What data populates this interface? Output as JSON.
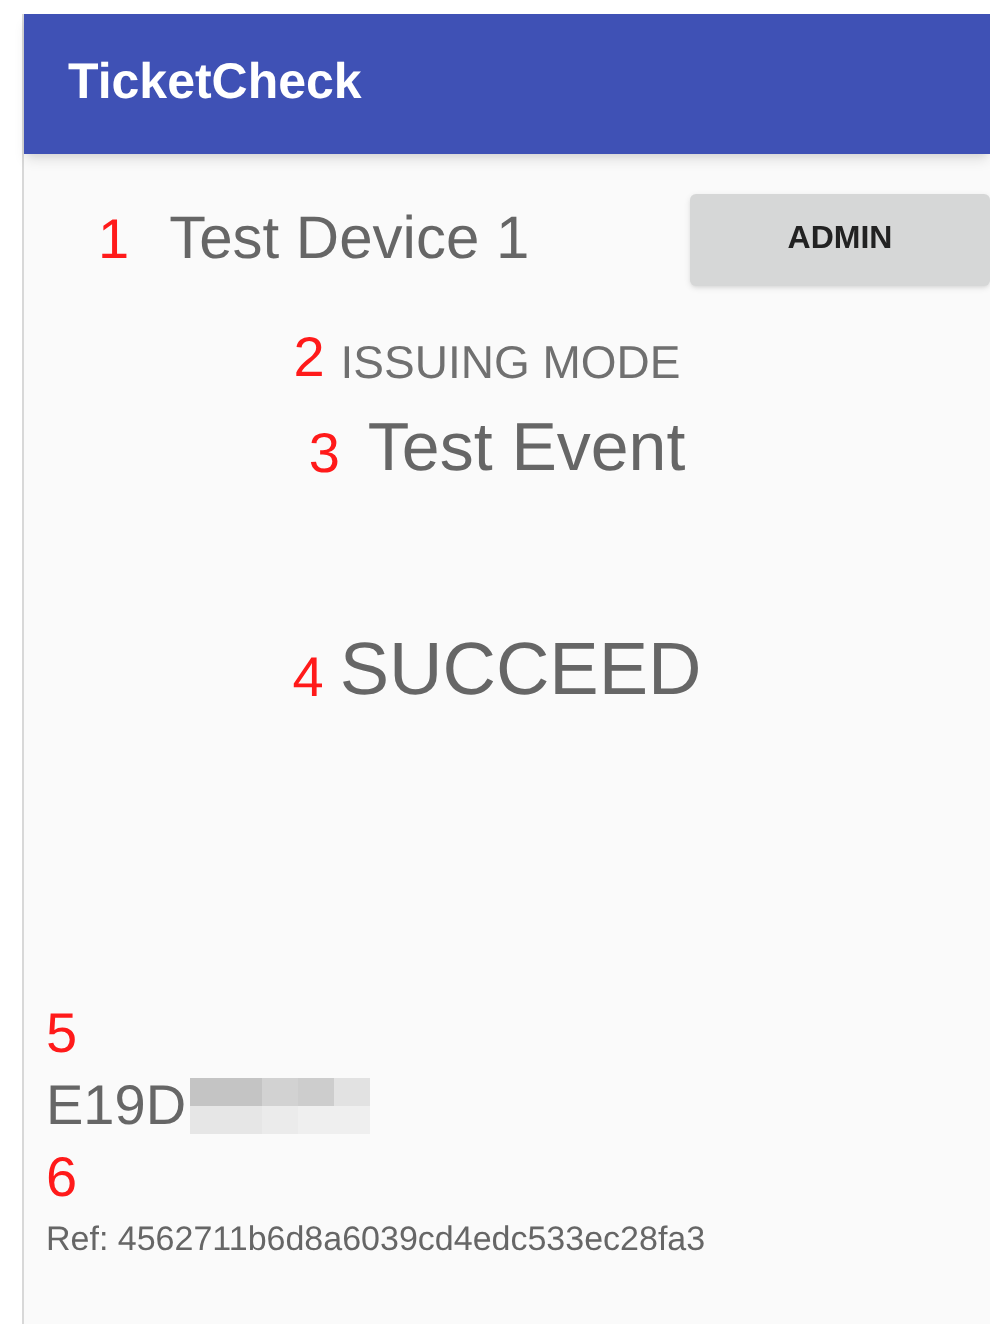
{
  "app_bar": {
    "title": "TicketCheck"
  },
  "device": {
    "marker": "1",
    "name": "Test Device 1"
  },
  "admin_button": {
    "label": "ADMIN"
  },
  "mode": {
    "marker": "2",
    "label": "ISSUING MODE"
  },
  "event": {
    "marker": "3",
    "name": "Test Event"
  },
  "result": {
    "marker": "4",
    "status": "SUCCEED"
  },
  "ticket_code": {
    "marker": "5",
    "value": "E19D",
    "redacted": true
  },
  "reference": {
    "marker": "6",
    "text": "Ref: 4562711b6d8a6039cd4edc533ec28fa3"
  }
}
